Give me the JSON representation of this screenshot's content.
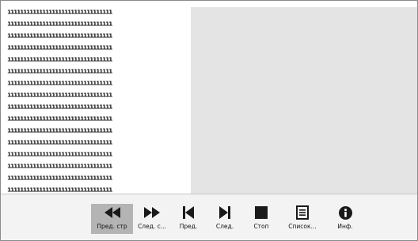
{
  "document": {
    "lines": [
      "111111111111111111111111111111111",
      "111111111111111111111111111111111",
      "111111111111111111111111111111111",
      "111111111111111111111111111111111",
      "111111111111111111111111111111111",
      "111111111111111111111111111111111",
      "111111111111111111111111111111111",
      "111111111111111111111111111111111",
      "111111111111111111111111111111111",
      "111111111111111111111111111111111",
      "111111111111111111111111111111111",
      "111111111111111111111111111111111",
      "111111111111111111111111111111111",
      "111111111111111111111111111111111",
      "111111111111111111111111111111111",
      "111111111111111111111111111111111"
    ]
  },
  "toolbar": {
    "buttons": [
      {
        "label": "Пред. стр",
        "icon": "rewind-icon",
        "active": true
      },
      {
        "label": "След. с...",
        "icon": "fast-forward-icon",
        "active": false
      },
      {
        "label": "Пред.",
        "icon": "skip-previous-icon",
        "active": false
      },
      {
        "label": "След.",
        "icon": "skip-next-icon",
        "active": false
      },
      {
        "label": "Стоп",
        "icon": "stop-icon",
        "active": false
      },
      {
        "label": "Список...",
        "icon": "list-icon",
        "active": false
      },
      {
        "label": "Инф.",
        "icon": "info-icon",
        "active": false
      }
    ]
  },
  "colors": {
    "viewer_bg": "#e4e4e4",
    "toolbar_bg": "#f3f3f3",
    "active_button": "#b4b4b4",
    "icon": "#1a1a1a"
  }
}
